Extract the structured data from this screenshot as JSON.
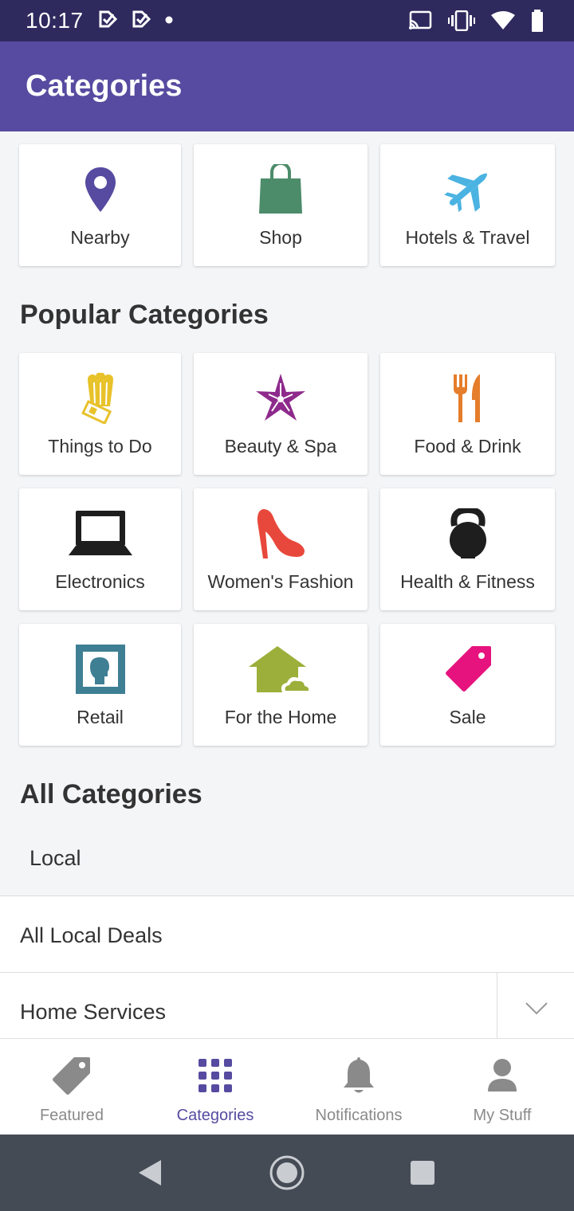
{
  "status_bar": {
    "time": "10:17",
    "left_icons": [
      "checkmark-notification-icon",
      "checkmark-notification-icon",
      "dot-icon"
    ],
    "right_icons": [
      "cast-icon",
      "vibrate-icon",
      "wifi-icon",
      "battery-icon"
    ]
  },
  "app_bar": {
    "title": "Categories"
  },
  "top_categories": [
    {
      "label": "Nearby",
      "icon": "location-pin-icon",
      "color": "#564ba0"
    },
    {
      "label": "Shop",
      "icon": "shopping-bag-icon",
      "color": "#4c8c6a"
    },
    {
      "label": "Hotels & Travel",
      "icon": "airplane-icon",
      "color": "#4ab3e2"
    }
  ],
  "popular_title": "Popular Categories",
  "popular_categories": [
    {
      "label": "Things to Do",
      "icon": "popcorn-ticket-icon",
      "color": "#e8c22a"
    },
    {
      "label": "Beauty & Spa",
      "icon": "flower-icon",
      "color": "#8e2a8c"
    },
    {
      "label": "Food & Drink",
      "icon": "fork-knife-icon",
      "color": "#e57d2b"
    },
    {
      "label": "Electronics",
      "icon": "laptop-icon",
      "color": "#1e1e1e"
    },
    {
      "label": "Women's Fashion",
      "icon": "high-heel-icon",
      "color": "#e8483b"
    },
    {
      "label": "Health & Fitness",
      "icon": "kettlebell-icon",
      "color": "#1e1e1e"
    },
    {
      "label": "Retail",
      "icon": "portrait-frame-icon",
      "color": "#3f7f94"
    },
    {
      "label": "For the Home",
      "icon": "house-icon",
      "color": "#9caf3a"
    },
    {
      "label": "Sale",
      "icon": "price-tag-icon",
      "color": "#e6137e"
    }
  ],
  "all_title": "All Categories",
  "local_label": "Local",
  "list_rows": [
    {
      "label": "All Local Deals"
    },
    {
      "label": "Home Services"
    }
  ],
  "bottom_nav": [
    {
      "label": "Featured",
      "icon": "tag-icon",
      "active": false
    },
    {
      "label": "Categories",
      "icon": "grid-icon",
      "active": true
    },
    {
      "label": "Notifications",
      "icon": "bell-icon",
      "active": false
    },
    {
      "label": "My Stuff",
      "icon": "person-icon",
      "active": false
    }
  ],
  "colors": {
    "status_bar": "#2e2a5e",
    "app_bar": "#564ba0",
    "accent": "#564ba0",
    "background": "#f4f5f7",
    "system_nav": "#454b55"
  }
}
